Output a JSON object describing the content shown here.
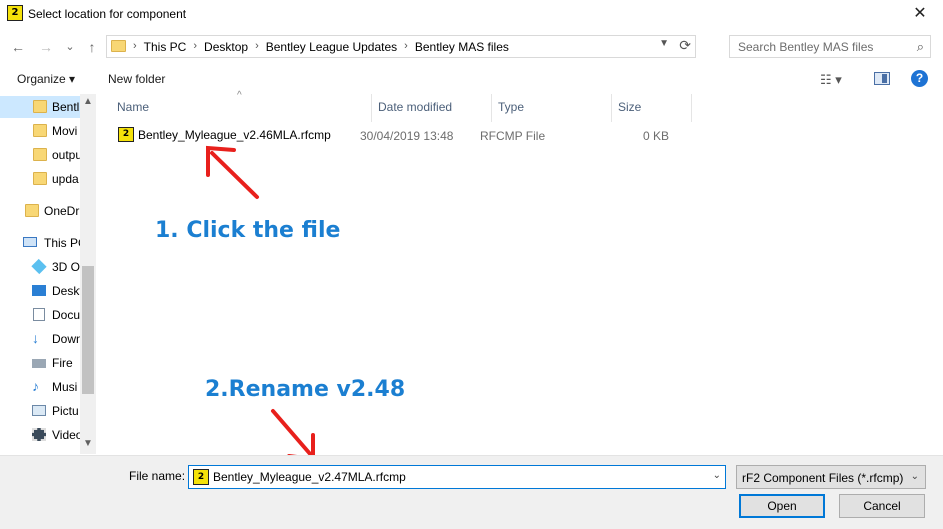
{
  "window": {
    "title": "Select location for component",
    "app_icon_glyph": "2",
    "close_glyph": "✕"
  },
  "nav": {
    "back_glyph": "←",
    "forward_glyph": "→",
    "recent_glyph": "⌄",
    "up_glyph": "↑"
  },
  "address": {
    "crumbs": [
      "This PC",
      "Desktop",
      "Bentley League Updates",
      "Bentley MAS files"
    ],
    "separator": "›"
  },
  "search": {
    "placeholder": "Search Bentley MAS files",
    "value": ""
  },
  "toolbar": {
    "organize_label": "Organize ▾",
    "new_folder_label": "New folder",
    "help_glyph": "?"
  },
  "sidebar": {
    "items": [
      {
        "label": "Bentl",
        "icon": "folder-icon",
        "selected": true
      },
      {
        "label": "Movi",
        "icon": "folder-icon"
      },
      {
        "label": "outpu",
        "icon": "folder-icon"
      },
      {
        "label": "upda",
        "icon": "folder-icon"
      },
      {
        "label": "OneDr",
        "icon": "folder-icon"
      },
      {
        "label": "This PC",
        "icon": "computer-icon"
      },
      {
        "label": "3D O",
        "icon": "3d-objects-icon"
      },
      {
        "label": "Deskt",
        "icon": "desktop-icon"
      },
      {
        "label": "Docu",
        "icon": "documents-icon"
      },
      {
        "label": "Down",
        "icon": "downloads-icon"
      },
      {
        "label": "Fire",
        "icon": "drive-icon"
      },
      {
        "label": "Musi",
        "icon": "music-icon"
      },
      {
        "label": "Pictu",
        "icon": "pictures-icon"
      },
      {
        "label": "Video",
        "icon": "videos-icon"
      }
    ]
  },
  "file_list": {
    "columns": [
      "Name",
      "Date modified",
      "Type",
      "Size"
    ],
    "rows": [
      {
        "name": "Bentley_Myleague_v2.46MLA.rfcmp",
        "date": "30/04/2019 13:48",
        "type": "RFCMP File",
        "size": "0 KB",
        "icon_glyph": "2"
      }
    ]
  },
  "annotations": {
    "step1": "1. Click the file",
    "step2": "2.Rename v2.48",
    "arrow_color": "#e8201c",
    "text_color": "#1b7fd1"
  },
  "bottom": {
    "file_name_label": "File name:",
    "file_name_value": "Bentley_Myleague_v2.47MLA.rfcmp",
    "file_type": "rF2 Component Files (*.rfcmp)",
    "open_label": "Open",
    "cancel_label": "Cancel"
  }
}
